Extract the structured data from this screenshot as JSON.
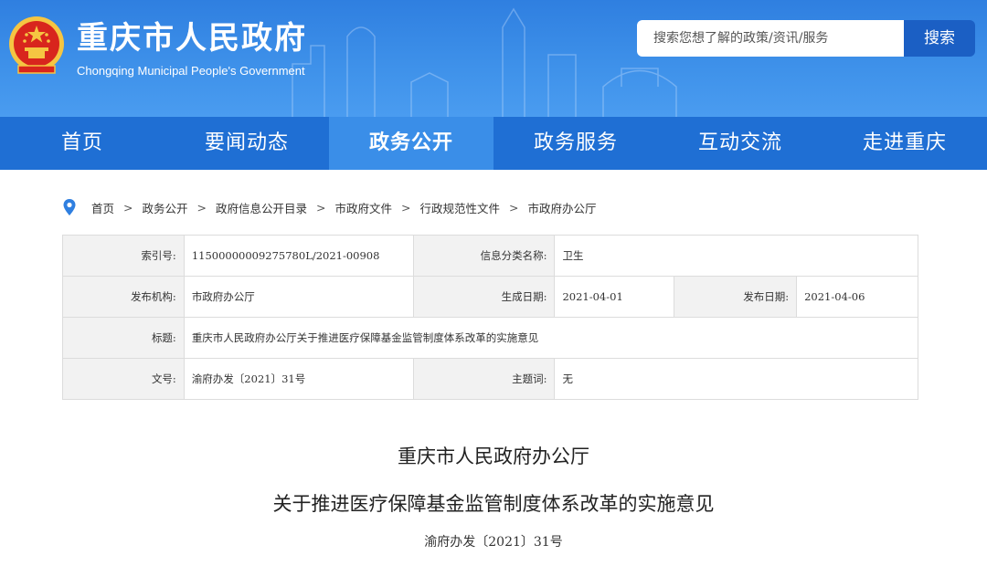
{
  "header": {
    "site_title": "重庆市人民政府",
    "site_subtitle": "Chongqing Municipal People's Government",
    "search_placeholder": "搜索您想了解的政策/资讯/服务",
    "search_button": "搜索",
    "icons": [
      "national-emblem-icon"
    ],
    "colors": {
      "header_blue": "#3f92ea",
      "nav_blue": "#1f6fd4",
      "nav_active": "#3a8ee8",
      "search_button": "#1b5fc4"
    }
  },
  "nav": {
    "items": [
      {
        "label": "首页"
      },
      {
        "label": "要闻动态"
      },
      {
        "label": "政务公开",
        "active": true
      },
      {
        "label": "政务服务"
      },
      {
        "label": "互动交流"
      },
      {
        "label": "走进重庆"
      }
    ]
  },
  "breadcrumb": {
    "icon": "location-pin-icon",
    "separator": ">",
    "items": [
      "首页",
      "政务公开",
      "政府信息公开目录",
      "市政府文件",
      "行政规范性文件",
      "市政府办公厅"
    ]
  },
  "info": {
    "index_label": "索引号:",
    "index_value": "11500000009275780L/2021-00908",
    "category_label": "信息分类名称:",
    "category_value": "卫生",
    "publisher_label": "发布机构:",
    "publisher_value": "市政府办公厅",
    "created_label": "生成日期:",
    "created_value": "2021-04-01",
    "published_label": "发布日期:",
    "published_value": "2021-04-06",
    "title_label": "标题:",
    "title_value": "重庆市人民政府办公厅关于推进医疗保障基金监管制度体系改革的实施意见",
    "docno_label": "文号:",
    "docno_value": "渝府办发〔2021〕31号",
    "keywords_label": "主题词:",
    "keywords_value": "无"
  },
  "document": {
    "issuer": "重庆市人民政府办公厅",
    "title": "关于推进医疗保障基金监管制度体系改革的实施意见",
    "number": "渝府办发〔2021〕31号"
  }
}
